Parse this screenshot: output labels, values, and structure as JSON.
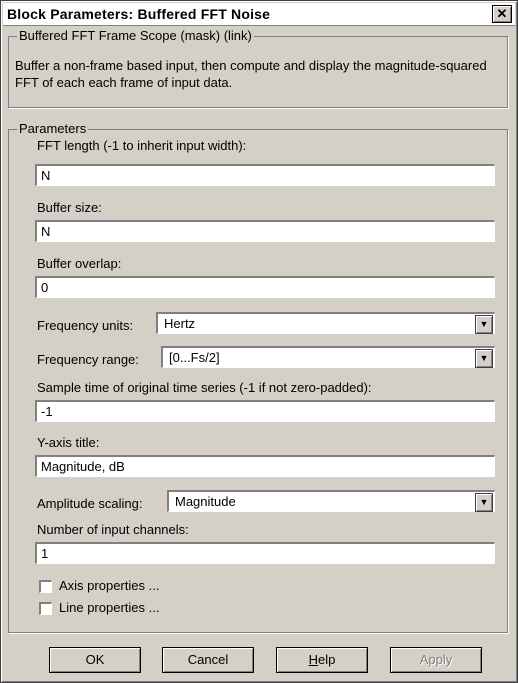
{
  "window": {
    "title": "Block Parameters: Buffered FFT Noise",
    "close_glyph": "✕"
  },
  "mask": {
    "legend": "Buffered FFT Frame Scope (mask) (link)",
    "description": "Buffer a non-frame based input, then compute and display the magnitude-squared FFT of each each frame of input data."
  },
  "params": {
    "legend": "Parameters",
    "fft_length": {
      "label": "FFT length (-1 to inherit input width):",
      "value": "N"
    },
    "buffer_size": {
      "label": "Buffer size:",
      "value": "N"
    },
    "buffer_overlap": {
      "label": "Buffer overlap:",
      "value": "0"
    },
    "frequency_units": {
      "label": "Frequency units:",
      "value": "Hertz"
    },
    "frequency_range": {
      "label": "Frequency range:",
      "value": "[0...Fs/2]"
    },
    "sample_time": {
      "label": "Sample time of original time series (-1 if not zero-padded):",
      "value": "-1"
    },
    "y_axis_title": {
      "label": "Y-axis title:",
      "value": "Magnitude, dB"
    },
    "amplitude_scaling": {
      "label": "Amplitude scaling:",
      "value": "Magnitude"
    },
    "num_channels": {
      "label": "Number of input channels:",
      "value": "1"
    },
    "axis_properties": {
      "label": "Axis properties ...",
      "checked": false
    },
    "line_properties": {
      "label": "Line properties ...",
      "checked": false
    }
  },
  "buttons": {
    "ok": "OK",
    "cancel": "Cancel",
    "help_u": "H",
    "help_rest": "elp",
    "apply": "Apply"
  },
  "icons": {
    "dropdown": "chevron-down-icon"
  }
}
